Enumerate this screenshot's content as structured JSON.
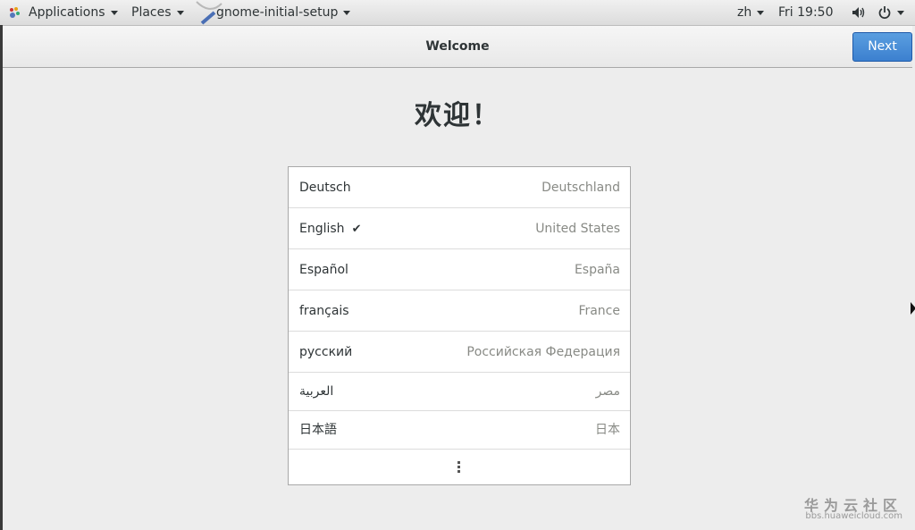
{
  "topbar": {
    "applications_label": "Applications",
    "places_label": "Places",
    "app_name": "gnome-initial-setup",
    "input_method": "zh",
    "clock": "Fri 19:50"
  },
  "header": {
    "title": "Welcome",
    "next_label": "Next"
  },
  "welcome_heading": "欢迎！",
  "languages": [
    {
      "name": "Deutsch",
      "region": "Deutschland",
      "selected": false
    },
    {
      "name": "English",
      "region": "United States",
      "selected": true
    },
    {
      "name": "Español",
      "region": "España",
      "selected": false
    },
    {
      "name": "français",
      "region": "France",
      "selected": false
    },
    {
      "name": "русский",
      "region": "Российская Федерация",
      "selected": false
    },
    {
      "name": "العربية",
      "region": "مصر",
      "selected": false
    },
    {
      "name": "日本語",
      "region": "日本",
      "selected": false
    }
  ],
  "check_mark": "✔",
  "watermark": {
    "line1": "华为云社区",
    "line2": "bbs.huaweicloud.com"
  },
  "colors": {
    "accent": "#3c80cf",
    "topbar": "#e4e4e4",
    "background": "#ededed"
  },
  "icons": [
    "gnome-foot-icon",
    "volume-icon",
    "power-icon",
    "more-vertical-icon"
  ]
}
